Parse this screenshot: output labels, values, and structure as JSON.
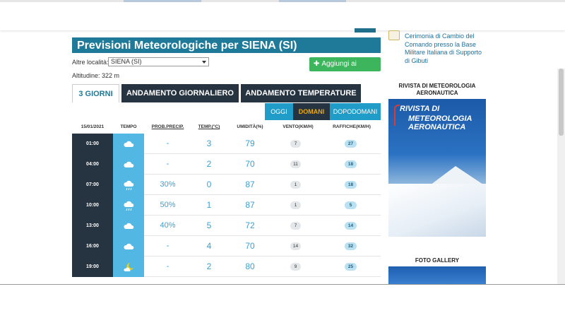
{
  "header": {
    "title": "Previsioni Meteorologiche per SIENA (SI)"
  },
  "location": {
    "label": "Altre località:",
    "selected": "SIENA (SI)",
    "altitude": "Altitudine: 322 m",
    "favorites_button": "Aggiungi ai preferiti"
  },
  "tabs": [
    "3 GIORNI",
    "ANDAMENTO GIORNALIERO",
    "ANDAMENTO TEMPERATURE"
  ],
  "days": [
    "OGGI",
    "DOMANI",
    "DOPODOMANI"
  ],
  "table": {
    "columns": [
      "15/01/2021",
      "TEMPO",
      "PROB.PRECIP.",
      "TEMP.(°C)",
      "UMIDITÀ(%)",
      "VENTO(KM/H)",
      "RAFFICHE(KM/H)"
    ],
    "rows": [
      {
        "time": "01:00",
        "weather": "cloud-icon",
        "prob": "-",
        "temp": "3",
        "hum": "79",
        "wind": "7",
        "gust": "27"
      },
      {
        "time": "04:00",
        "weather": "cloud-icon",
        "prob": "-",
        "temp": "2",
        "hum": "70",
        "wind": "11",
        "gust": "18"
      },
      {
        "time": "07:00",
        "weather": "rain-cloud-icon",
        "prob": "30%",
        "temp": "0",
        "hum": "87",
        "wind": "1",
        "gust": "18"
      },
      {
        "time": "10:00",
        "weather": "rain-cloud-icon",
        "prob": "50%",
        "temp": "1",
        "hum": "87",
        "wind": "1",
        "gust": "5"
      },
      {
        "time": "13:00",
        "weather": "cloud-icon",
        "prob": "40%",
        "temp": "5",
        "hum": "72",
        "wind": "7",
        "gust": "14"
      },
      {
        "time": "16:00",
        "weather": "cloud-icon",
        "prob": "-",
        "temp": "4",
        "hum": "70",
        "wind": "14",
        "gust": "32"
      },
      {
        "time": "19:00",
        "weather": "moon-cloud-icon",
        "prob": "-",
        "temp": "2",
        "hum": "80",
        "wind": "9",
        "gust": "25"
      }
    ]
  },
  "sidebar": {
    "news": "Cerimonia di Cambio del Comando presso la Base Militare Italiana di Supporto di Gibuti",
    "magazine_heading": "RIVISTA DI METEOROLOGIA AERONAUTICA",
    "magazine_cover_title_1": "RIVISTA DI",
    "magazine_cover_title_2": "METEOROLOGIA AERONAUTICA",
    "gallery_heading": "FOTO GALLERY"
  },
  "colors": {
    "accent": "#1f7a99",
    "dark": "#263340",
    "green": "#3cb55c",
    "sky": "#52b8e3",
    "value": "#3aa0d0"
  }
}
